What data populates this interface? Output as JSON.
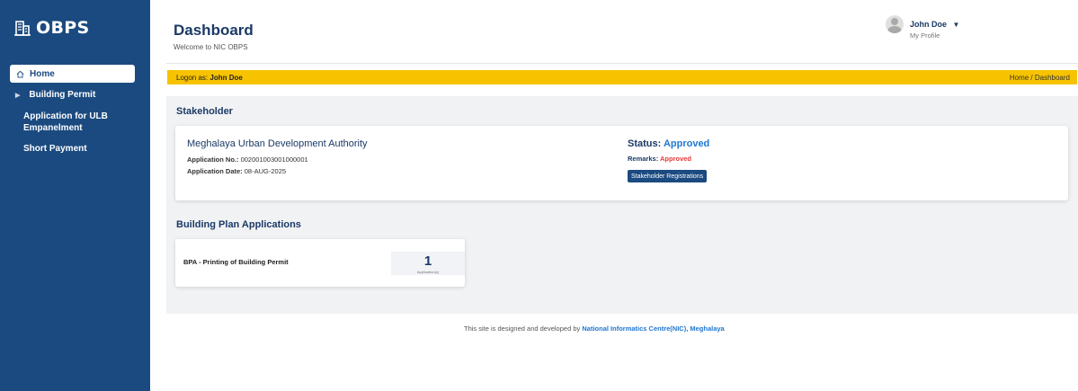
{
  "sidebar": {
    "brand": "OBPS",
    "items": [
      {
        "label": "Home"
      },
      {
        "label": "Building Permit"
      },
      {
        "label": "Application for ULB Empanelment"
      },
      {
        "label": "Short Payment"
      }
    ]
  },
  "header": {
    "title": "Dashboard",
    "subtitle": "Welcome to NIC OBPS",
    "user_name": "John Doe",
    "user_link": "My Profile"
  },
  "logon_bar": {
    "prefix": "Logon as:",
    "user": "John Doe",
    "breadcrumb": "Home / Dashboard"
  },
  "stakeholder": {
    "section_title": "Stakeholder",
    "org_name": "Meghalaya Urban Development Authority",
    "app_no_label": "Application No.:",
    "app_no_value": "002001003001000001",
    "app_date_label": "Application Date:",
    "app_date_value": "08-AUG-2025",
    "status_label": "Status:",
    "status_value": "Approved",
    "remarks_label": "Remarks:",
    "remarks_value": "Approved",
    "button_label": "Stakeholder Registrations"
  },
  "building_plan": {
    "section_title": "Building Plan Applications",
    "card_label": "BPA - Printing of Building Permit",
    "count": "1",
    "count_label": "Application(s)"
  },
  "footer": {
    "text": "This site is designed and developed by",
    "link": "National Informatics Centre(NIC), Meghalaya"
  },
  "colors": {
    "sidebar": "#1b4a80",
    "logon_bar": "#f7c300",
    "status": "#1f77d0",
    "remarks": "#e53935"
  },
  "icons": [
    "building-icon",
    "home-icon",
    "chevron-right-icon",
    "avatar-icon",
    "caret-down-icon"
  ]
}
